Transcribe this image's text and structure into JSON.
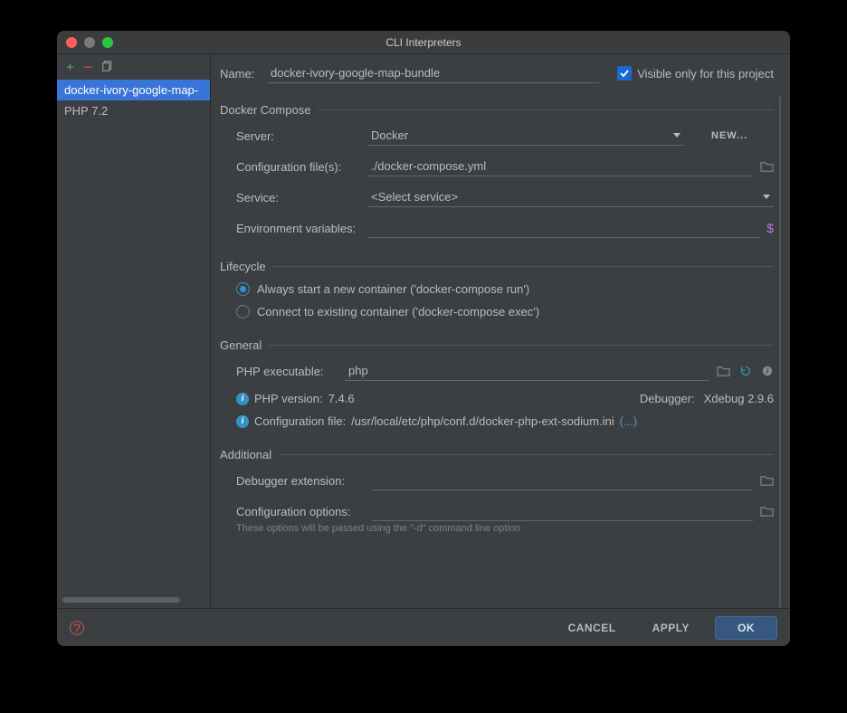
{
  "window_title": "CLI Interpreters",
  "sidebar": {
    "items": [
      {
        "label": "docker-ivory-google-map-"
      },
      {
        "label": "PHP 7.2"
      }
    ]
  },
  "name_label": "Name:",
  "name_value": "docker-ivory-google-map-bundle",
  "visible_only_label": "Visible only for this project",
  "sections": {
    "docker_compose": "Docker Compose",
    "lifecycle": "Lifecycle",
    "general": "General",
    "additional": "Additional"
  },
  "docker": {
    "server_label": "Server:",
    "server_value": "Docker",
    "new_button": "NEW...",
    "config_files_label": "Configuration file(s):",
    "config_files_value": "./docker-compose.yml",
    "service_label": "Service:",
    "service_value": "<Select service>",
    "env_label": "Environment variables:",
    "env_value": ""
  },
  "lifecycle": {
    "always_new": "Always start a new container ('docker-compose run')",
    "connect_existing": "Connect to existing container ('docker-compose exec')"
  },
  "general": {
    "php_exe_label": "PHP executable:",
    "php_exe_value": "php",
    "php_version_label": "PHP version:",
    "php_version_value": "7.4.6",
    "debugger_label": "Debugger:",
    "debugger_value": "Xdebug 2.9.6",
    "conf_file_label": "Configuration file:",
    "conf_file_value": "/usr/local/etc/php/conf.d/docker-php-ext-sodium.ini",
    "conf_file_more": "(...)"
  },
  "additional": {
    "debugger_ext_label": "Debugger extension:",
    "debugger_ext_value": "",
    "config_options_label": "Configuration options:",
    "config_options_value": "",
    "hint": "These options will be passed using the \"-d\" command line option"
  },
  "footer": {
    "cancel": "CANCEL",
    "apply": "APPLY",
    "ok": "OK"
  }
}
